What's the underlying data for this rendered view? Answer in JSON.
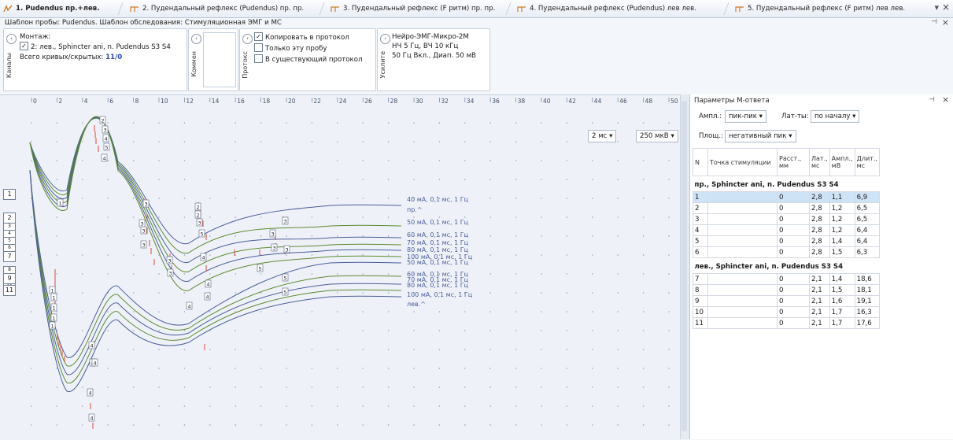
{
  "tabs": [
    {
      "label": "1. Pudendus пр.+лев.",
      "active": true
    },
    {
      "label": "2. Пудендальный рефлекс (Pudendus) пр. пр.",
      "active": false
    },
    {
      "label": "3. Пудендальный рефлекс (F ритм) пр. пр.",
      "active": false
    },
    {
      "label": "4. Пудендальный рефлекс (Pudendus) лев лев.",
      "active": false
    },
    {
      "label": "5. Пудендальный рефлекс (F ритм) лев лев.",
      "active": false
    }
  ],
  "template_title": "Шаблон пробы: Pudendus. Шаблон обследования: Стимуляционная ЭМГ и МС",
  "channels": {
    "vlabel": "Каналы",
    "montage_label": "Монтаж:",
    "montage_item": "2: лев., Sphincter ani, n. Pudendus S3 S4",
    "total_label": "Всего кривых/скрытых:",
    "total_value": "11/0"
  },
  "comment": {
    "vlabel": "Коммен"
  },
  "protocol": {
    "vlabel": "Протокс",
    "copy_label": "Копировать в протокол",
    "only_this_label": "Только эту пробу",
    "existing_label": "В существующий протокол"
  },
  "amplifier": {
    "vlabel": "Усилите",
    "name": "Нейро-ЭМГ-Микро-2М",
    "line2": "НЧ 5 Гц, ВЧ 10 кГц",
    "line3": "50 Гц Вкл., Диап. 50 мВ"
  },
  "chart": {
    "time_ticks": [
      "0",
      "2",
      "4",
      "6",
      "8",
      "10",
      "12",
      "14",
      "16",
      "18",
      "20",
      "22",
      "24",
      "26",
      "28",
      "30",
      "32",
      "34",
      "36",
      "38",
      "40",
      "42",
      "44",
      "46",
      "48",
      "50"
    ],
    "time_scale": "2 мс",
    "amp_scale": "250 мкВ",
    "channel_buttons": [
      "1",
      "2",
      "3",
      "4",
      "5",
      "6",
      "7",
      "8",
      "9",
      "10",
      "11"
    ],
    "curve_labels": [
      "40 мА, 0,1 мс, 1 Гц",
      "пр.^",
      "50 мА, 0,1 мс, 1 Гц",
      "60 мА, 0,1 мс, 1 Гц",
      "70 мА, 0,1 мс, 1 Гц",
      "80 мА, 0,1 мс, 1 Гц",
      "100 мА, 0,1 мс, 1 Гц",
      "50 мА, 0,1 мс, 1 Гц",
      "60 мА, 0,1 мс, 1 Гц",
      "70 мА, 0,1 мс, 1 Гц",
      "80 мА, 0,1 мс, 1 Гц",
      "100 мА, 0,1 мс, 1 Гц",
      "лев.^"
    ]
  },
  "mparams": {
    "title": "Параметры М-ответа",
    "ampl_label": "Ампл.:",
    "ampl_value": "пик-пик",
    "lat_label": "Лат-ты:",
    "lat_value": "по началу",
    "area_label": "Площ.:",
    "area_value": "негативный пик",
    "headers": [
      "N",
      "Точка стимуляции",
      "Расст., мм",
      "Лат., мс",
      "Ампл., мВ",
      "Длит., мс"
    ],
    "group1": "пр., Sphincter ani, n. Pudendus S3 S4",
    "rows1": [
      [
        "1",
        "",
        "0",
        "2,8",
        "1,1",
        "6,9"
      ],
      [
        "2",
        "",
        "0",
        "2,8",
        "1,2",
        "6,5"
      ],
      [
        "3",
        "",
        "0",
        "2,8",
        "1,2",
        "6,5"
      ],
      [
        "4",
        "",
        "0",
        "2,8",
        "1,2",
        "6,4"
      ],
      [
        "5",
        "",
        "0",
        "2,8",
        "1,4",
        "6,4"
      ],
      [
        "6",
        "",
        "0",
        "2,8",
        "1,5",
        "6,3"
      ]
    ],
    "group2": "лев., Sphincter ani, n. Pudendus S3 S4",
    "rows2": [
      [
        "7",
        "",
        "0",
        "2,1",
        "1,4",
        "18,6"
      ],
      [
        "8",
        "",
        "0",
        "2,1",
        "1,5",
        "18,1"
      ],
      [
        "9",
        "",
        "0",
        "2,1",
        "1,6",
        "19,1"
      ],
      [
        "10",
        "",
        "0",
        "2,1",
        "1,7",
        "16,3"
      ],
      [
        "11",
        "",
        "0",
        "2,1",
        "1,7",
        "17,6"
      ]
    ]
  },
  "colors": {
    "blue_trace": "#4a5d9a",
    "green_trace": "#5c8a2e",
    "marker": "#d9493a",
    "accent": "#3a5fa6"
  }
}
